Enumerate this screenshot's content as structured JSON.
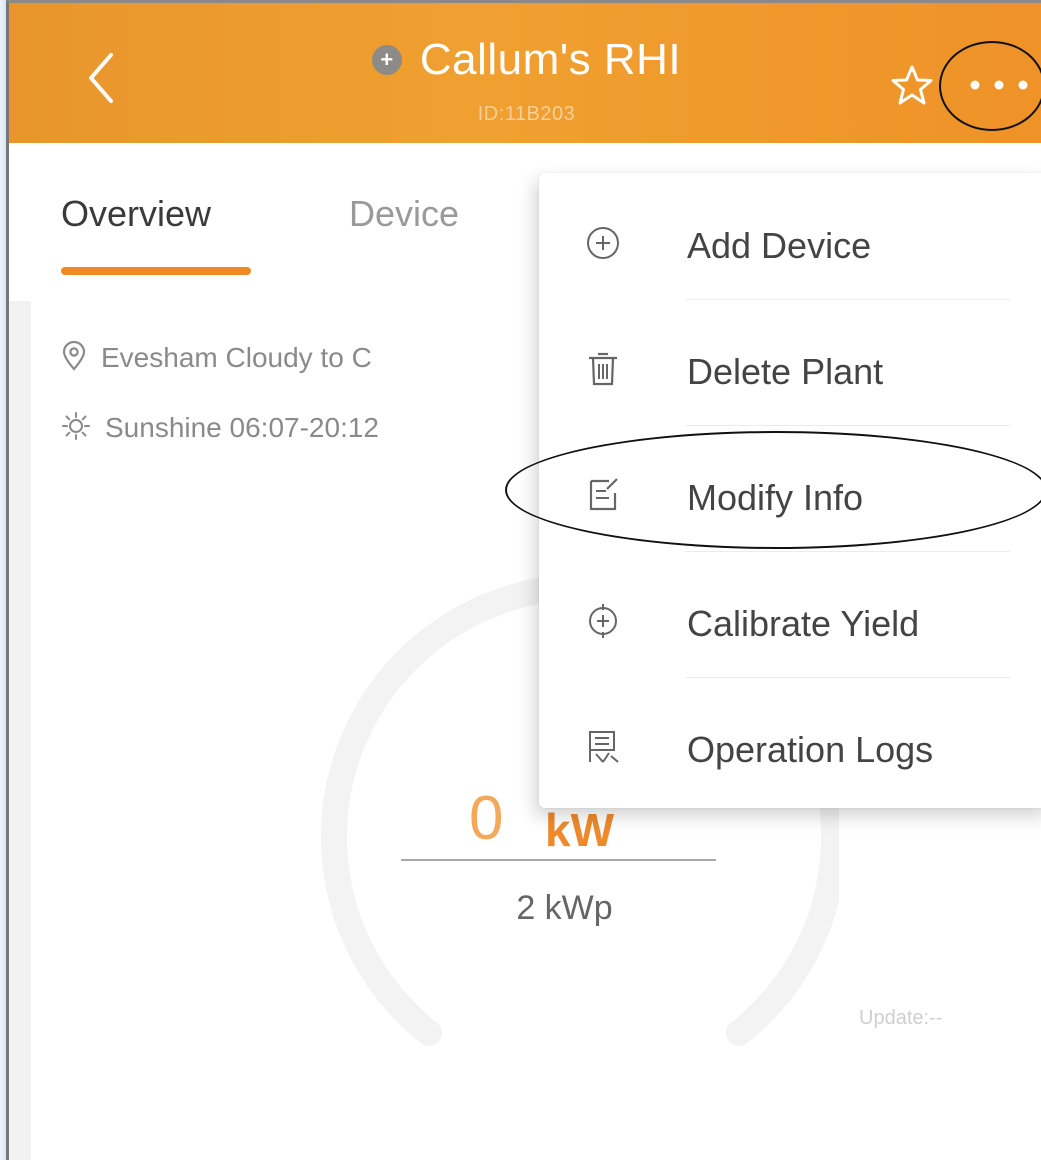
{
  "header": {
    "back_icon": "chevron-left-icon",
    "plant_icon": "plus-circle-icon",
    "title": "Callum's RHI",
    "subtitle": "ID:11B203",
    "favorite_icon": "star-outline-icon",
    "more_icon": "more-horizontal-icon",
    "bg_color": "#F0A030"
  },
  "tabs": [
    {
      "label": "Overview",
      "active": true
    },
    {
      "label": "Device",
      "active": false
    }
  ],
  "overview": {
    "location_icon": "location-pin-icon",
    "location_text": "Evesham Cloudy to C",
    "sun_icon": "sun-icon",
    "sunshine_text": "Sunshine 06:07-20:12",
    "power_value": "0",
    "power_unit": "kW",
    "capacity": "2 kWp",
    "update_text": "Update:--"
  },
  "menu": {
    "items": [
      {
        "label": "Add Device",
        "icon": "add-circle-icon"
      },
      {
        "label": "Delete Plant",
        "icon": "trash-icon"
      },
      {
        "label": "Modify Info",
        "icon": "edit-document-icon"
      },
      {
        "label": "Calibrate Yield",
        "icon": "calibrate-icon"
      },
      {
        "label": "Operation Logs",
        "icon": "log-list-icon"
      }
    ]
  },
  "colors": {
    "accent": "#EF8A24",
    "text_primary": "#3A3A3A",
    "text_muted": "#8A8A8A"
  }
}
